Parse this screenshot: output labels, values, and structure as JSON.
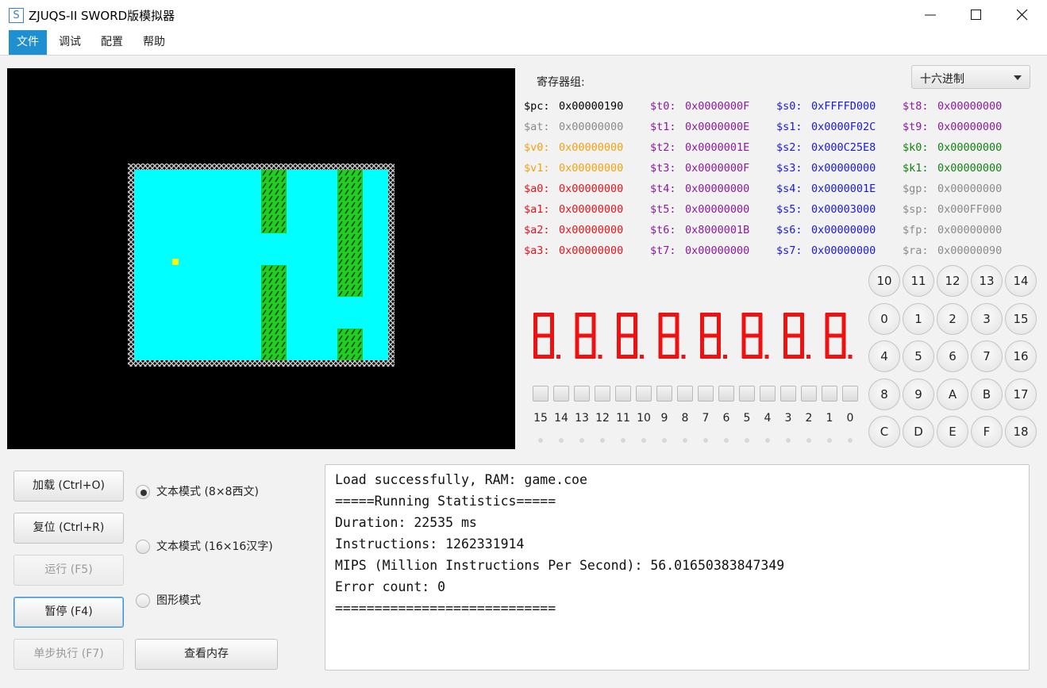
{
  "window": {
    "icon_letter": "S",
    "title": "ZJUQS-II SWORD版模拟器"
  },
  "menu": [
    "文件",
    "调试",
    "配置",
    "帮助"
  ],
  "screen": {
    "background": "#000000",
    "playfield_color": "#00ffff",
    "pillar_color": "#1fcf1f",
    "ball_color": "#ffff00"
  },
  "registers": {
    "title": "寄存器组:",
    "base_select": "十六进制",
    "columns": [
      [
        {
          "name": "$pc:",
          "value": "0x00000190",
          "color": "black"
        },
        {
          "name": "$at:",
          "value": "0x00000000",
          "color": "gray"
        },
        {
          "name": "$v0:",
          "value": "0x00000000",
          "color": "orange"
        },
        {
          "name": "$v1:",
          "value": "0x00000000",
          "color": "orange"
        },
        {
          "name": "$a0:",
          "value": "0x00000000",
          "color": "red"
        },
        {
          "name": "$a1:",
          "value": "0x00000000",
          "color": "red"
        },
        {
          "name": "$a2:",
          "value": "0x00000000",
          "color": "red"
        },
        {
          "name": "$a3:",
          "value": "0x00000000",
          "color": "red"
        }
      ],
      [
        {
          "name": "$t0:",
          "value": "0x0000000F",
          "color": "purple"
        },
        {
          "name": "$t1:",
          "value": "0x0000000E",
          "color": "purple"
        },
        {
          "name": "$t2:",
          "value": "0x0000001E",
          "color": "purple"
        },
        {
          "name": "$t3:",
          "value": "0x0000000F",
          "color": "purple"
        },
        {
          "name": "$t4:",
          "value": "0x00000000",
          "color": "purple"
        },
        {
          "name": "$t5:",
          "value": "0x00000000",
          "color": "purple"
        },
        {
          "name": "$t6:",
          "value": "0x8000001B",
          "color": "purple"
        },
        {
          "name": "$t7:",
          "value": "0x00000000",
          "color": "purple"
        }
      ],
      [
        {
          "name": "$s0:",
          "value": "0xFFFFD000",
          "color": "blue"
        },
        {
          "name": "$s1:",
          "value": "0x0000F02C",
          "color": "blue"
        },
        {
          "name": "$s2:",
          "value": "0x000C25E8",
          "color": "blue"
        },
        {
          "name": "$s3:",
          "value": "0x00000000",
          "color": "blue"
        },
        {
          "name": "$s4:",
          "value": "0x0000001E",
          "color": "blue"
        },
        {
          "name": "$s5:",
          "value": "0x00003000",
          "color": "blue"
        },
        {
          "name": "$s6:",
          "value": "0x00000000",
          "color": "blue"
        },
        {
          "name": "$s7:",
          "value": "0x00000000",
          "color": "blue"
        }
      ],
      [
        {
          "name": "$t8:",
          "value": "0x00000000",
          "color": "purple"
        },
        {
          "name": "$t9:",
          "value": "0x00000000",
          "color": "purple"
        },
        {
          "name": "$k0:",
          "value": "0x00000000",
          "color": "green"
        },
        {
          "name": "$k1:",
          "value": "0x00000000",
          "color": "green"
        },
        {
          "name": "$gp:",
          "value": "0x00000000",
          "color": "gray"
        },
        {
          "name": "$sp:",
          "value": "0x000FF000",
          "color": "gray"
        },
        {
          "name": "$fp:",
          "value": "0x00000000",
          "color": "gray"
        },
        {
          "name": "$ra:",
          "value": "0x00000090",
          "color": "gray"
        }
      ]
    ]
  },
  "seven_segment": {
    "digits": "88888888",
    "color": "#ee1111"
  },
  "switches": {
    "labels": [
      "15",
      "14",
      "13",
      "12",
      "11",
      "10",
      "9",
      "8",
      "7",
      "6",
      "5",
      "4",
      "3",
      "2",
      "1",
      "0"
    ]
  },
  "keypad": {
    "keys": [
      [
        "10",
        "11",
        "12",
        "13",
        "14"
      ],
      [
        "0",
        "1",
        "2",
        "3",
        "15"
      ],
      [
        "4",
        "5",
        "6",
        "7",
        "16"
      ],
      [
        "8",
        "9",
        "A",
        "B",
        "17"
      ],
      [
        "C",
        "D",
        "E",
        "F",
        "18"
      ]
    ]
  },
  "controls": {
    "load": "加载 (Ctrl+O)",
    "reset": "复位 (Ctrl+R)",
    "run": "运行 (F5)",
    "pause": "暂停 (F4)",
    "step": "单步执行 (F7)",
    "view_memory": "查看内存"
  },
  "modes": {
    "text_8x8": "文本模式 (8×8西文)",
    "text_16x16": "文本模式 (16×16汉字)",
    "graphic": "图形模式",
    "selected": "text_8x8"
  },
  "console": {
    "lines": [
      "Load successfully, RAM: game.coe",
      "=====Running Statistics=====",
      "Duration: 22535 ms",
      "Instructions: 1262331914",
      "MIPS (Million Instructions Per Second): 56.01650383847349",
      "Error count: 0",
      "============================"
    ]
  }
}
